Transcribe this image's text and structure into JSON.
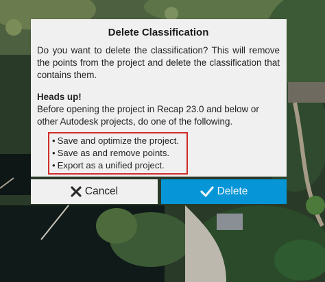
{
  "dialog": {
    "title": "Delete Classification",
    "message": "Do you want to delete the classification? This will remove the points from the project and delete the classification that contains them.",
    "heads_up_title": "Heads up!",
    "heads_up_body": "Before opening the project in Recap 23.0 and below or other Autodesk projects, do one of the following.",
    "options": [
      "Save and optimize the project.",
      "Save as and remove points.",
      "Export as a unified project."
    ],
    "bullet": "•"
  },
  "buttons": {
    "cancel_label": "Cancel",
    "cancel_icon": "x-icon",
    "delete_label": "Delete",
    "delete_icon": "check-icon"
  },
  "colors": {
    "accent": "#0696d7",
    "highlight_border": "#d22a2a",
    "dialog_bg": "#f0f0f0"
  }
}
